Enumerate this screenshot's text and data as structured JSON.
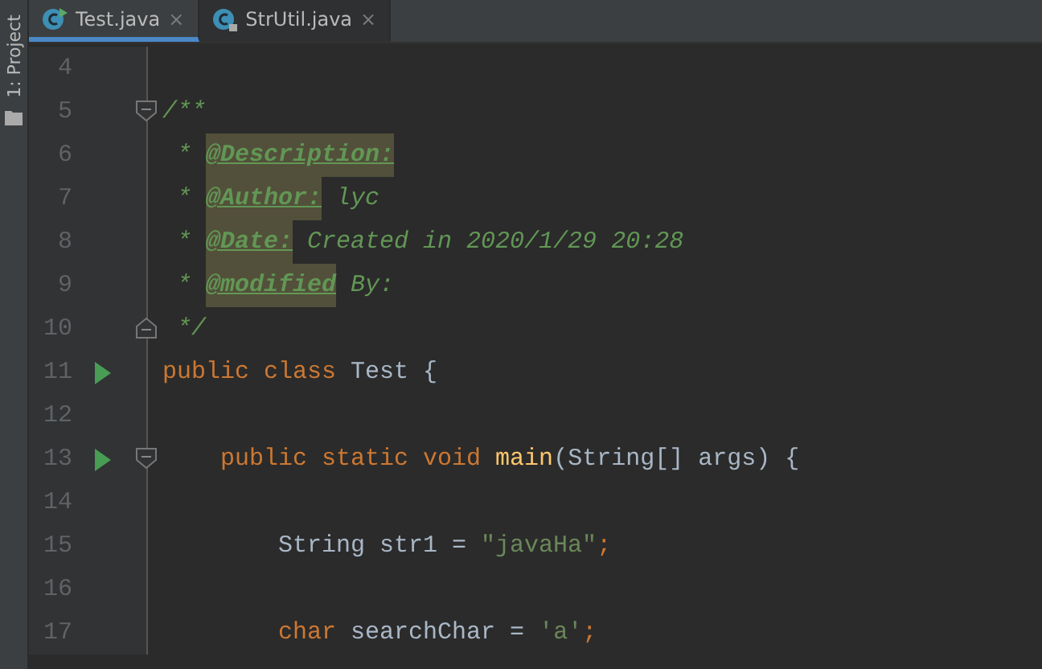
{
  "tool_strip": {
    "label": "1: Project"
  },
  "tabs": [
    {
      "label": "Test.java",
      "selected": true,
      "kind": "runnable",
      "close": "×"
    },
    {
      "label": "StrUtil.java",
      "selected": false,
      "kind": "locked",
      "close": "×"
    }
  ],
  "lines": [
    {
      "number": "4",
      "run": false,
      "fold_start": false,
      "fold_end": false
    },
    {
      "number": "5",
      "run": false,
      "fold_start": true,
      "fold_end": false,
      "tokens": [
        {
          "kind": "comment",
          "text": "/**"
        }
      ]
    },
    {
      "number": "6",
      "run": false,
      "fold_start": false,
      "fold_end": false,
      "tokens": [
        {
          "kind": "comment",
          "text": " * "
        },
        {
          "kind": "doctag",
          "text": "@Description:"
        }
      ]
    },
    {
      "number": "7",
      "run": false,
      "fold_start": false,
      "fold_end": false,
      "tokens": [
        {
          "kind": "comment",
          "text": " * "
        },
        {
          "kind": "doctag",
          "text": "@Author:"
        },
        {
          "kind": "comment",
          "text": " lyc"
        }
      ]
    },
    {
      "number": "8",
      "run": false,
      "fold_start": false,
      "fold_end": false,
      "tokens": [
        {
          "kind": "comment",
          "text": " * "
        },
        {
          "kind": "doctag",
          "text": "@Date:"
        },
        {
          "kind": "comment",
          "text": " Created in 2020/1/29 20:28"
        }
      ]
    },
    {
      "number": "9",
      "run": false,
      "fold_start": false,
      "fold_end": false,
      "tokens": [
        {
          "kind": "comment",
          "text": " * "
        },
        {
          "kind": "doctag",
          "text": "@modified"
        },
        {
          "kind": "comment",
          "text": " By:"
        }
      ]
    },
    {
      "number": "10",
      "run": false,
      "fold_start": false,
      "fold_end": true,
      "tokens": [
        {
          "kind": "comment",
          "text": " */"
        }
      ]
    },
    {
      "number": "11",
      "run": true,
      "fold_start": false,
      "fold_end": false,
      "tokens": [
        {
          "kind": "keyword",
          "text": "public class"
        },
        {
          "kind": "plain",
          "text": " Test {"
        }
      ]
    },
    {
      "number": "12",
      "run": false,
      "fold_start": false,
      "fold_end": false
    },
    {
      "number": "13",
      "run": true,
      "fold_start": true,
      "fold_end": false,
      "tokens": [
        {
          "kind": "keyword",
          "text": "    public static void "
        },
        {
          "kind": "method",
          "text": "main"
        },
        {
          "kind": "plain",
          "text": "(String[] args) {"
        }
      ]
    },
    {
      "number": "14",
      "run": false,
      "fold_start": false,
      "fold_end": false
    },
    {
      "number": "15",
      "run": false,
      "fold_start": false,
      "fold_end": false,
      "tokens": [
        {
          "kind": "plain",
          "text": "        String str1 = "
        },
        {
          "kind": "string",
          "text": "\"javaHa\""
        },
        {
          "kind": "keyword",
          "text": ";"
        }
      ]
    },
    {
      "number": "16",
      "run": false,
      "fold_start": false,
      "fold_end": false
    },
    {
      "number": "17",
      "run": false,
      "fold_start": false,
      "fold_end": false,
      "tokens": [
        {
          "kind": "keyword",
          "text": "        char"
        },
        {
          "kind": "plain",
          "text": " searchChar = "
        },
        {
          "kind": "string",
          "text": "'a'"
        },
        {
          "kind": "keyword",
          "text": ";"
        }
      ]
    }
  ]
}
